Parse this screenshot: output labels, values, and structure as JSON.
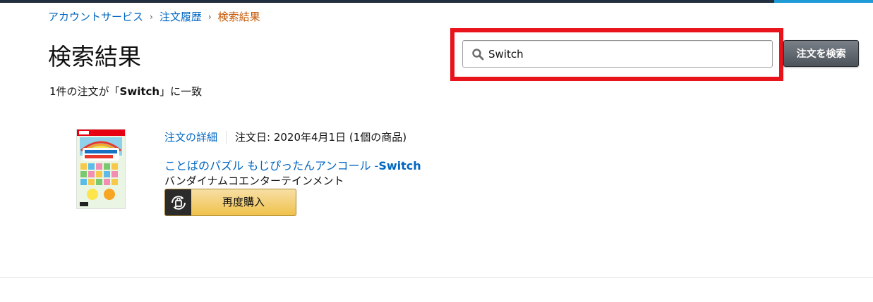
{
  "breadcrumb": {
    "items": [
      "アカウントサービス",
      "注文履歴"
    ],
    "current": "検索結果",
    "separator": "›"
  },
  "page": {
    "title": "検索結果",
    "summary_prefix": "1件の注文が「",
    "summary_query": "Switch",
    "summary_suffix": "」に一致"
  },
  "search": {
    "value": "Switch",
    "button_label": "注文を検索"
  },
  "order": {
    "details_link": "注文の詳細",
    "date_text": "注文日: 2020年4月1日 (1個の商品)",
    "product_title_main": "ことばのパズル もじぴったんアンコール -",
    "product_title_bold": "Switch",
    "seller": "バンダイナムコエンターテインメント",
    "buy_again_label": "再度購入"
  },
  "colors": {
    "link": "#0066c0",
    "breadcrumb_current": "#c45500",
    "highlight": "#e8131b",
    "button_dark": "#4d535a",
    "buy_again": "#f0c14b"
  },
  "icons": {
    "search": "search-icon",
    "buy_again": "buy-again-icon",
    "breadcrumb_separator": "chevron-right-icon"
  }
}
